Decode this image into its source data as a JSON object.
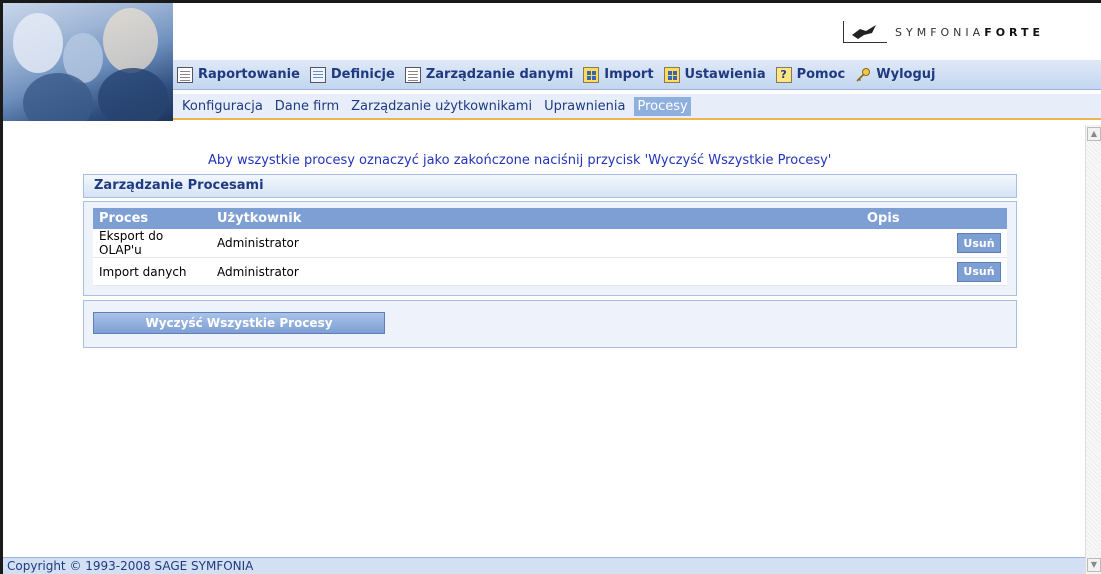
{
  "brand": {
    "logo_light": "SYMFONIA",
    "logo_bold": "FORTE"
  },
  "menu": [
    {
      "label": "Raportowanie",
      "icon": "document-icon"
    },
    {
      "label": "Definicje",
      "icon": "document-edit-icon"
    },
    {
      "label": "Zarządzanie danymi",
      "icon": "document-list-icon"
    },
    {
      "label": "Import",
      "icon": "grid-icon"
    },
    {
      "label": "Ustawienia",
      "icon": "grid-icon"
    },
    {
      "label": "Pomoc",
      "icon": "help-icon"
    },
    {
      "label": "Wyloguj",
      "icon": "key-icon"
    }
  ],
  "submenu": [
    {
      "label": "Konfiguracja",
      "active": false
    },
    {
      "label": "Dane firm",
      "active": false
    },
    {
      "label": "Zarządzanie użytkownikami",
      "active": false
    },
    {
      "label": "Uprawnienia",
      "active": false
    },
    {
      "label": "Procesy",
      "active": true
    }
  ],
  "hint": "Aby wszystkie procesy oznaczyć jako zakończone naciśnij przycisk 'Wyczyść Wszystkie Procesy'",
  "panel_title": "Zarządzanie Procesami",
  "table": {
    "headers": [
      "Proces",
      "Użytkownik",
      "Opis"
    ],
    "rows": [
      {
        "proces": "Eksport do OLAP'u",
        "user": "Administrator",
        "opis": "",
        "action": "Usuń"
      },
      {
        "proces": "Import danych",
        "user": "Administrator",
        "opis": "",
        "action": "Usuń"
      }
    ]
  },
  "clear_button": "Wyczyść Wszystkie Procesy",
  "footer": "Copyright © 1993-2008 SAGE SYMFONIA",
  "colors": {
    "accent": "#1f3a80",
    "header_blue": "#7e9fd3",
    "underline_orange": "#f0b24a"
  }
}
